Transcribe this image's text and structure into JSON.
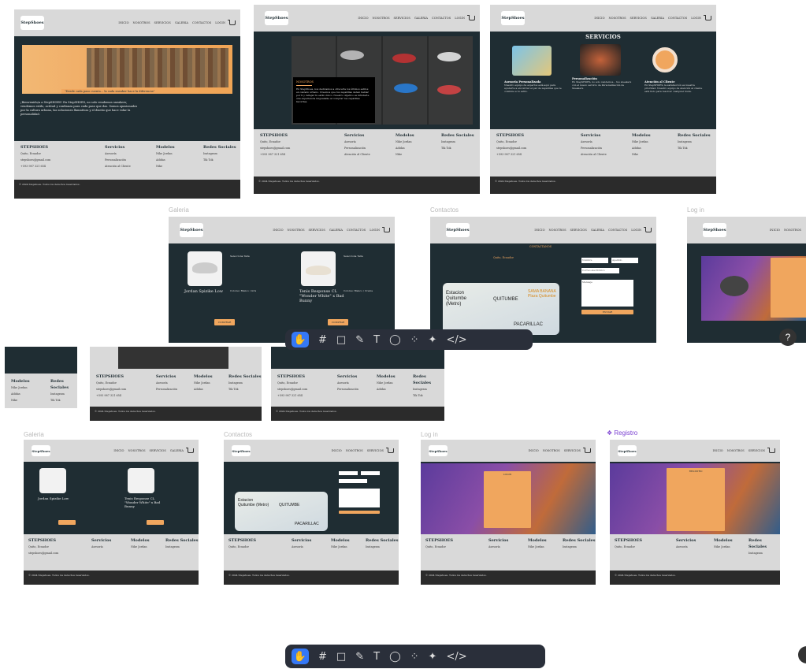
{
  "brand": "StepShoes",
  "nav": [
    "INICIO",
    "NOSOTROS",
    "SERVICIOS",
    "GALERIA",
    "CONTACTOS",
    "LOGIN"
  ],
  "frame_titles": {
    "galeria": "Galeria",
    "contactos": "Contactos",
    "login": "Log in",
    "registro": "Registro"
  },
  "home": {
    "slogan": "\"Desde cada paso cuenta... la cada sneaker hace la diferencia\"",
    "intro": "¡Bienvenido/a a StepSHOES! En StepSHOES, no solo vendemos sneakers; vendemos estilo, actitud y confianza para cada paso que das. Somos apasionados por la cultura urbana, las soluciones llamativas y el diseño que hace volar la personalidad."
  },
  "nosotros": {
    "title": "NOSOTROS",
    "text": "En StepShoes, nos dedicamos a ofrecerte los últimos estilos en calzado urbano. Creemos que tus zapatillas deben hablar por ti y reflejar tu estilo único. Nuestro objetivo es brindarte una experiencia inigualable al comprar tus zapatillas favoritas."
  },
  "servicios": {
    "title": "SERVICIOS",
    "items": [
      {
        "title": "Asesoria Personalizada",
        "text": "Nuestro equipo de expertos está aquí para ayudarte a encontrar el par de zapatillas que te combine a tu estilo."
      },
      {
        "title": "Personalización",
        "text": "En StepSHOES, no solo vendemos... tus sneakers con el nuevo servicio de Personalización de Sneakers."
      },
      {
        "title": "Atención al Cliente",
        "text": "En StepSHOES, la satisfacción es nuestra prioridad. Nuestro equipo de atención al cliente está listo para resolver cualquier duda."
      }
    ]
  },
  "footer": {
    "brand": "STEPSHOES",
    "location": "Quito, Ecuador",
    "email": "stepshoes@gmail.com",
    "phone": "+593 987 321 654",
    "headers": [
      "Servicios",
      "Modelos",
      "Redes Sociales"
    ],
    "servicios": [
      "Asesoría",
      "Personalización",
      "Atención al Cliente"
    ],
    "modelos": [
      "Nike Jordan",
      "Adidas",
      "Nike"
    ],
    "redes": [
      "Instagram",
      "Tik Tok"
    ],
    "copyright": "© 2024 Stepshoes. Todos los derechos reservados."
  },
  "galeria": {
    "products": [
      {
        "name": "Jordan Spizike Low",
        "sizes_title": "Selecciona Talla",
        "colors": "Colores: Blanco / Gris"
      },
      {
        "name": "Tenis Response CL \"Wonder White\" x Bad Bunny",
        "sizes_title": "Selecciona Talla",
        "colors": "Colores: Blanco / Crema"
      }
    ],
    "buy": "COMPRAR"
  },
  "contactos": {
    "title": "CONTACTANOS",
    "location": "Quito, Ecuador",
    "map_labels": [
      "Estacion Quitumbe (Metro)",
      "QUITUMBE",
      "SAMA BANANA Plaza Quitumbe",
      "PACARILLAC"
    ],
    "fields": [
      "Nombre",
      "Apellido",
      "Correo electrónico",
      "Mensaje"
    ],
    "send": "ENVIAR"
  },
  "login": {
    "title": "LOGIN",
    "button": "Iniciar Sesion"
  },
  "registro": {
    "title": "REGISTRO",
    "button": "Registrarse"
  },
  "toolbar": [
    "hand",
    "frame",
    "shape",
    "pen",
    "text",
    "comment",
    "components",
    "dev"
  ],
  "help": "?"
}
